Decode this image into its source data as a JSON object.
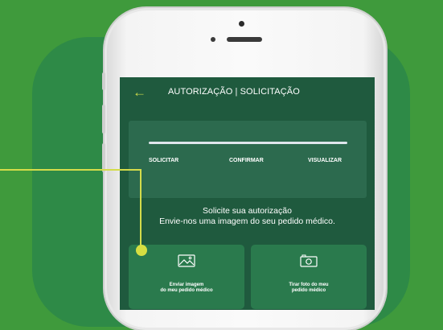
{
  "header": {
    "back_icon": "arrow-left-icon",
    "title": "AUTORIZAÇÃO | SOLICITAÇÃO"
  },
  "stepper": {
    "progress": 1.0,
    "steps": [
      "SOLICITAR",
      "CONFIRMAR",
      "VISUALIZAR"
    ]
  },
  "instructions": {
    "line1": "Solicite sua autorização",
    "line2": "Envie-nos uma imagem do seu pedido médico."
  },
  "actions": {
    "upload": {
      "icon": "image-icon",
      "line1": "Enviar imagem",
      "line2": "do meu pedido médico"
    },
    "camera": {
      "icon": "camera-icon",
      "line1": "Tirar foto do meu",
      "line2": "pedido médico"
    }
  },
  "colors": {
    "background": "#3f9a3c",
    "screen": "#1f5a3e",
    "card": "#2a7a4d",
    "accent": "#d4dc4a"
  }
}
